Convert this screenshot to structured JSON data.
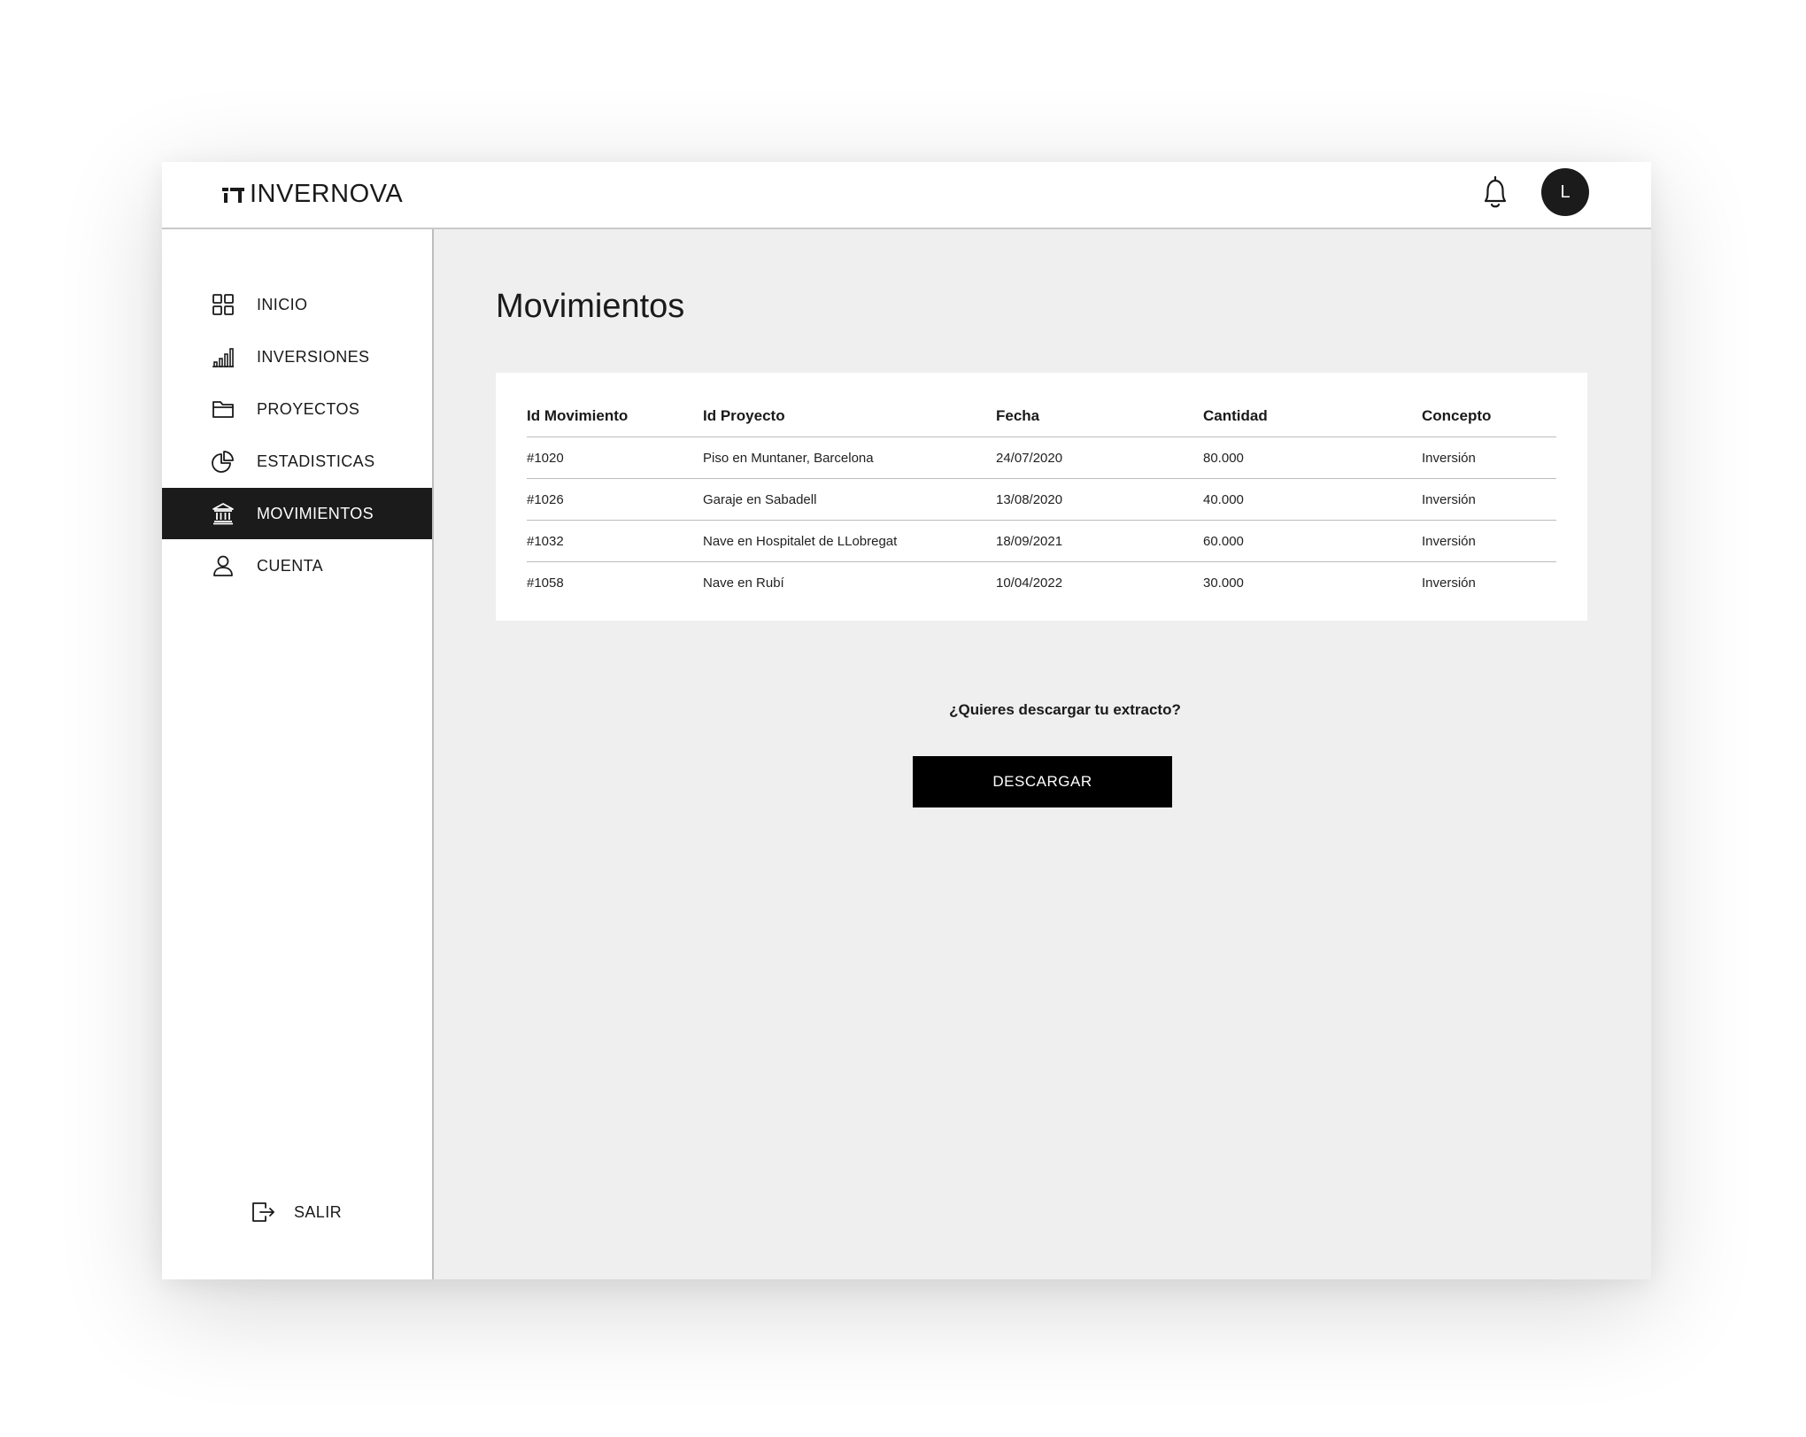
{
  "brand": {
    "name": "INVERNOVA"
  },
  "header": {
    "avatar_initial": "L"
  },
  "sidebar": {
    "items": [
      {
        "label": "INICIO",
        "icon": "grid-icon"
      },
      {
        "label": "INVERSIONES",
        "icon": "bar-chart-icon"
      },
      {
        "label": "PROYECTOS",
        "icon": "folder-icon"
      },
      {
        "label": "ESTADISTICAS",
        "icon": "pie-chart-icon"
      },
      {
        "label": "MOVIMIENTOS",
        "icon": "bank-icon",
        "active": true
      },
      {
        "label": "CUENTA",
        "icon": "user-icon"
      }
    ],
    "logout_label": "SALIR"
  },
  "main": {
    "title": "Movimientos",
    "table": {
      "headers": [
        "Id Movimiento",
        "Id Proyecto",
        "Fecha",
        "Cantidad",
        "Concepto"
      ],
      "rows": [
        [
          "#1020",
          "Piso en Muntaner, Barcelona",
          "24/07/2020",
          "80.000",
          "Inversión"
        ],
        [
          "#1026",
          "Garaje en Sabadell",
          "13/08/2020",
          "40.000",
          "Inversión"
        ],
        [
          "#1032",
          "Nave en Hospitalet de LLobregat",
          "18/09/2021",
          "60.000",
          "Inversión"
        ],
        [
          "#1058",
          "Nave en Rubí",
          "10/04/2022",
          "30.000",
          "Inversión"
        ]
      ]
    },
    "download_prompt": "¿Quieres descargar tu extracto?",
    "download_label": "DESCARGAR"
  },
  "colors": {
    "active_bg": "#1b1b1b",
    "content_bg": "#efefef",
    "button_bg": "#000000"
  }
}
